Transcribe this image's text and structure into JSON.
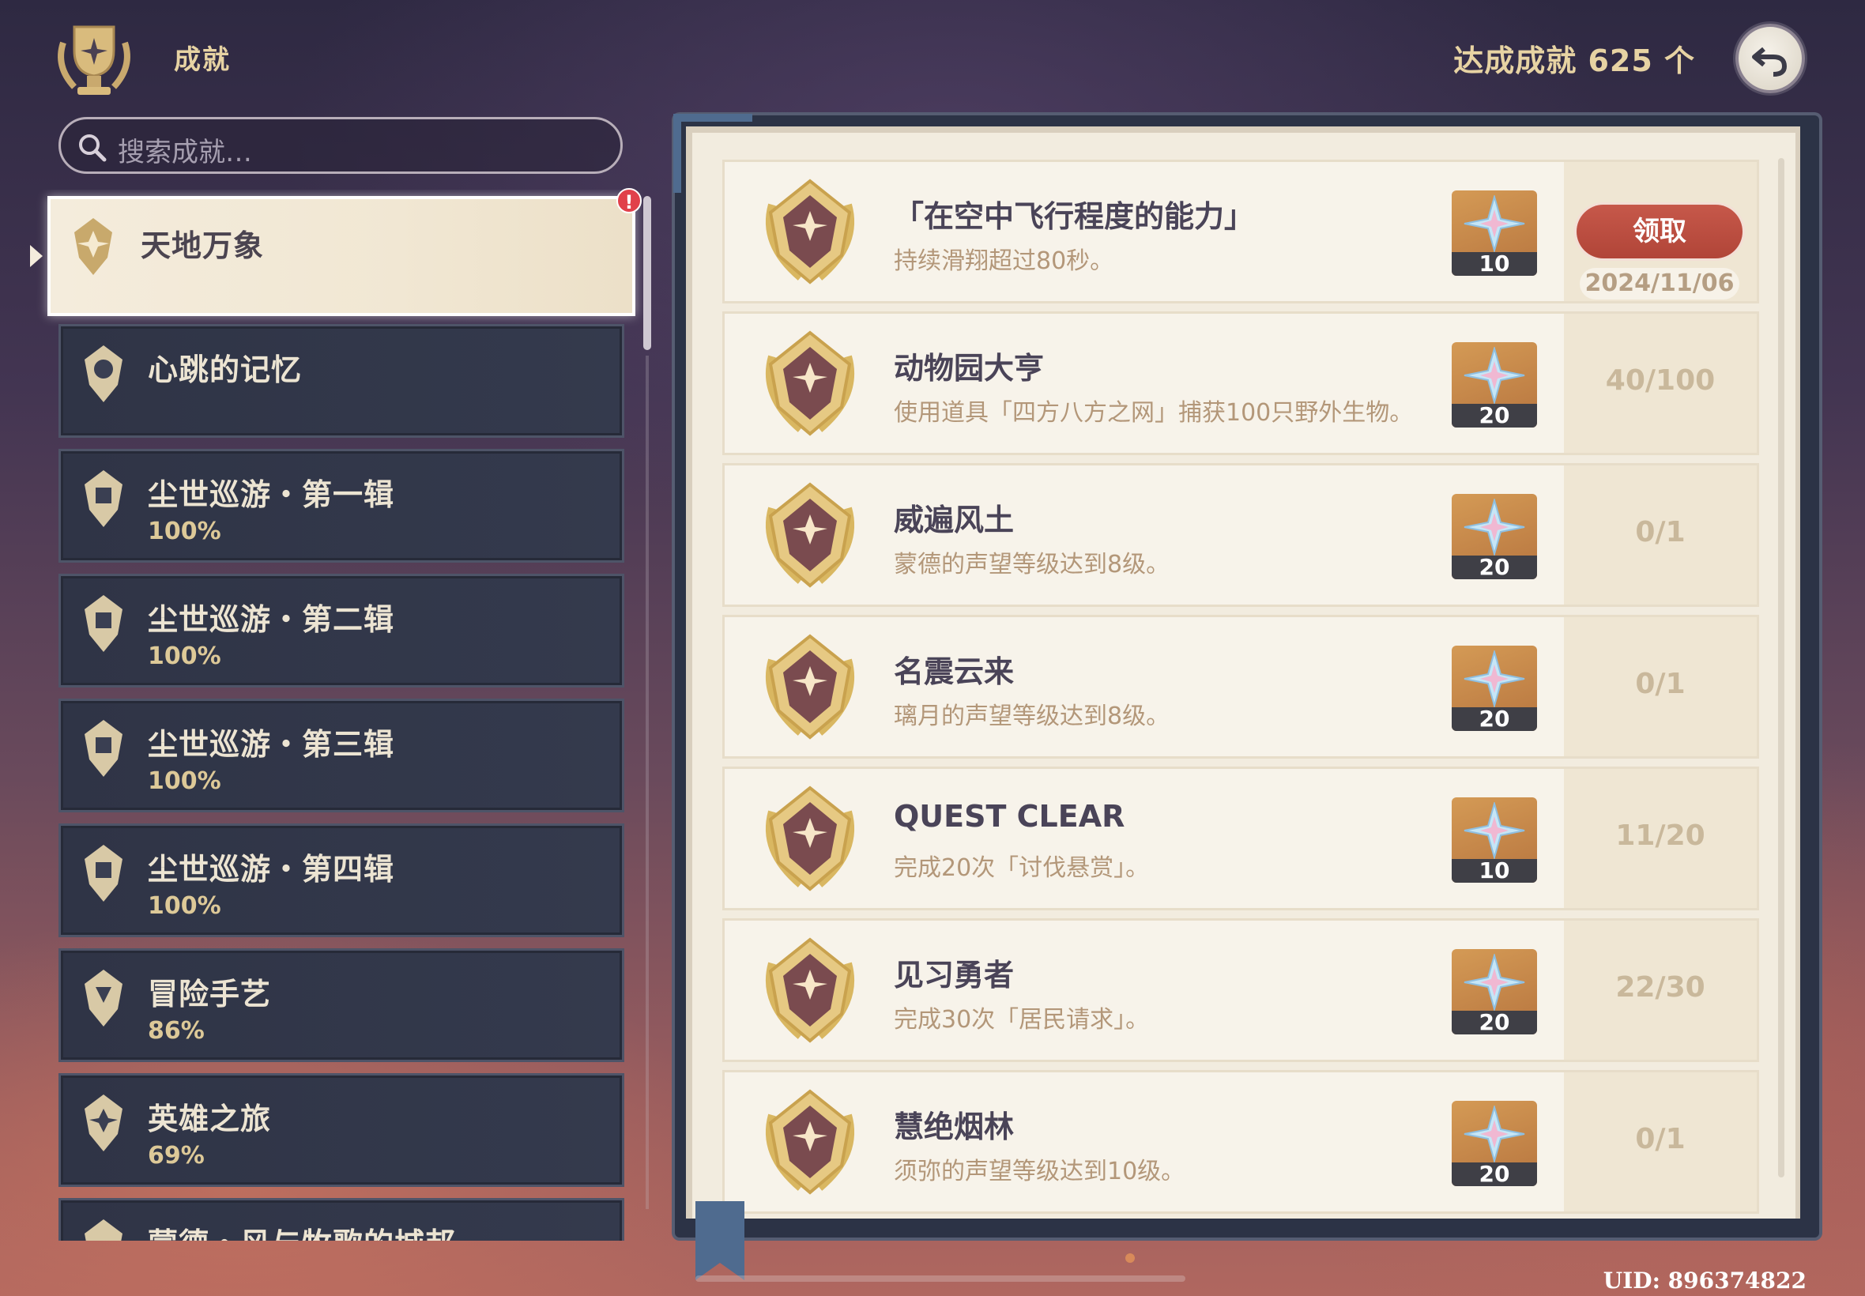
{
  "header": {
    "title": "成就",
    "achievement_count": "达成成就 625 个",
    "back_icon": "back-arrow-icon"
  },
  "search": {
    "placeholder": "搜索成就…"
  },
  "sidebar": {
    "alert_badge": "!",
    "items": [
      {
        "name": "天地万象",
        "percent": "",
        "active": true
      },
      {
        "name": "心跳的记忆",
        "percent": ""
      },
      {
        "name": "尘世巡游・第一辑",
        "percent": "100%"
      },
      {
        "name": "尘世巡游・第二辑",
        "percent": "100%"
      },
      {
        "name": "尘世巡游・第三辑",
        "percent": "100%"
      },
      {
        "name": "尘世巡游・第四辑",
        "percent": "100%"
      },
      {
        "name": "冒险手艺",
        "percent": "86%"
      },
      {
        "name": "英雄之旅",
        "percent": "69%"
      },
      {
        "name": "蒙德・风与牧歌的城邦",
        "percent": ""
      }
    ]
  },
  "achievements": [
    {
      "title": "「在空中飞行程度的能力」",
      "desc": "持续滑翔超过80秒。",
      "reward": "10",
      "claim_label": "领取",
      "date": "2024/11/06"
    },
    {
      "title": "动物园大亨",
      "desc": "使用道具「四方八方之网」捕获100只野外生物。",
      "reward": "20",
      "progress": "40/100"
    },
    {
      "title": "威遍风土",
      "desc": "蒙德的声望等级达到8级。",
      "reward": "20",
      "progress": "0/1"
    },
    {
      "title": "名震云来",
      "desc": "璃月的声望等级达到8级。",
      "reward": "20",
      "progress": "0/1"
    },
    {
      "title": "QUEST CLEAR",
      "desc": "完成20次「讨伐悬赏」。",
      "reward": "10",
      "progress": "11/20"
    },
    {
      "title": "见习勇者",
      "desc": "完成30次「居民请求」。",
      "reward": "20",
      "progress": "22/30"
    },
    {
      "title": "慧绝烟林",
      "desc": "须弥的声望等级达到10级。",
      "reward": "20",
      "progress": "0/1"
    }
  ],
  "footer": {
    "uid": "UID: 896374822"
  },
  "colors": {
    "accent_gold": "#e7d3a3",
    "claim_red": "#b14538",
    "page_bg": "#f2ecdf"
  }
}
